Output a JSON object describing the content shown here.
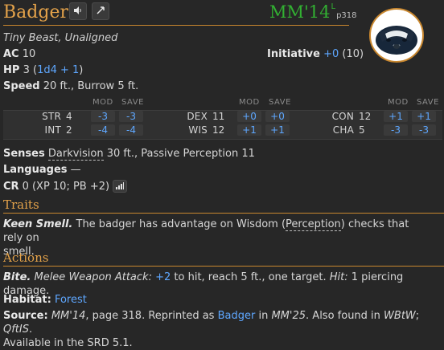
{
  "header": {
    "name": "Badger",
    "source_code": "MM'14",
    "source_sup": "L",
    "source_page": "p318",
    "buttons": {
      "speak": "🔊",
      "share": "⊿"
    }
  },
  "meta": {
    "type_line": "Tiny Beast, Unaligned",
    "ac_label": "AC",
    "ac_value": "10",
    "initiative_label": "Initiative",
    "initiative_value": "+0",
    "initiative_paren": "(10)",
    "hp_label": "HP",
    "hp_value": "3",
    "hp_dice": "1d4 + 1",
    "speed_label": "Speed",
    "speed_value": "20 ft., Burrow 5 ft."
  },
  "stat_headers": {
    "mod": "MOD",
    "save": "SAVE"
  },
  "stats": [
    {
      "name": "STR",
      "value": "4",
      "mod": "-3",
      "save": "-3"
    },
    {
      "name": "INT",
      "value": "2",
      "mod": "-4",
      "save": "-4"
    },
    {
      "name": "DEX",
      "value": "11",
      "mod": "+0",
      "save": "+0"
    },
    {
      "name": "WIS",
      "value": "12",
      "mod": "+1",
      "save": "+1"
    },
    {
      "name": "CON",
      "value": "12",
      "mod": "+1",
      "save": "+1"
    },
    {
      "name": "CHA",
      "value": "5",
      "mod": "-3",
      "save": "-3"
    }
  ],
  "senses": {
    "label": "Senses",
    "darkvision": "Darkvision",
    "rest": "30 ft., Passive Perception 11"
  },
  "languages": {
    "label": "Languages",
    "value": "—"
  },
  "cr": {
    "label": "CR",
    "value": "0 (XP 10; PB +2)"
  },
  "traits": {
    "title": "Traits",
    "keen_name": "Keen Smell.",
    "keen_text_1": "The badger has advantage on Wisdom (",
    "keen_perception": "Perception",
    "keen_text_2": ") checks that rely on",
    "keen_text_3": "smell."
  },
  "actions": {
    "title": "Actions",
    "bite_name": "Bite.",
    "attack_type": "Melee Weapon Attack:",
    "to_hit": "+2",
    "after_hit": "to hit, reach 5 ft., one target.",
    "hit_label": "Hit:",
    "damage": "1 piercing damage."
  },
  "habitat": {
    "label": "Habitat:",
    "value": "Forest"
  },
  "source": {
    "label": "Source:",
    "book": "MM'14",
    "page_text": ", page 318. Reprinted as",
    "reprint_link": "Badger",
    "in_text": "in",
    "reprint_book": "MM'25",
    "also_text": ". Also found in",
    "wbtw": "WBtW",
    "sep": ";",
    "qftis": "QftIS",
    "end": ".",
    "srd": "Available in the SRD 5.1."
  }
}
